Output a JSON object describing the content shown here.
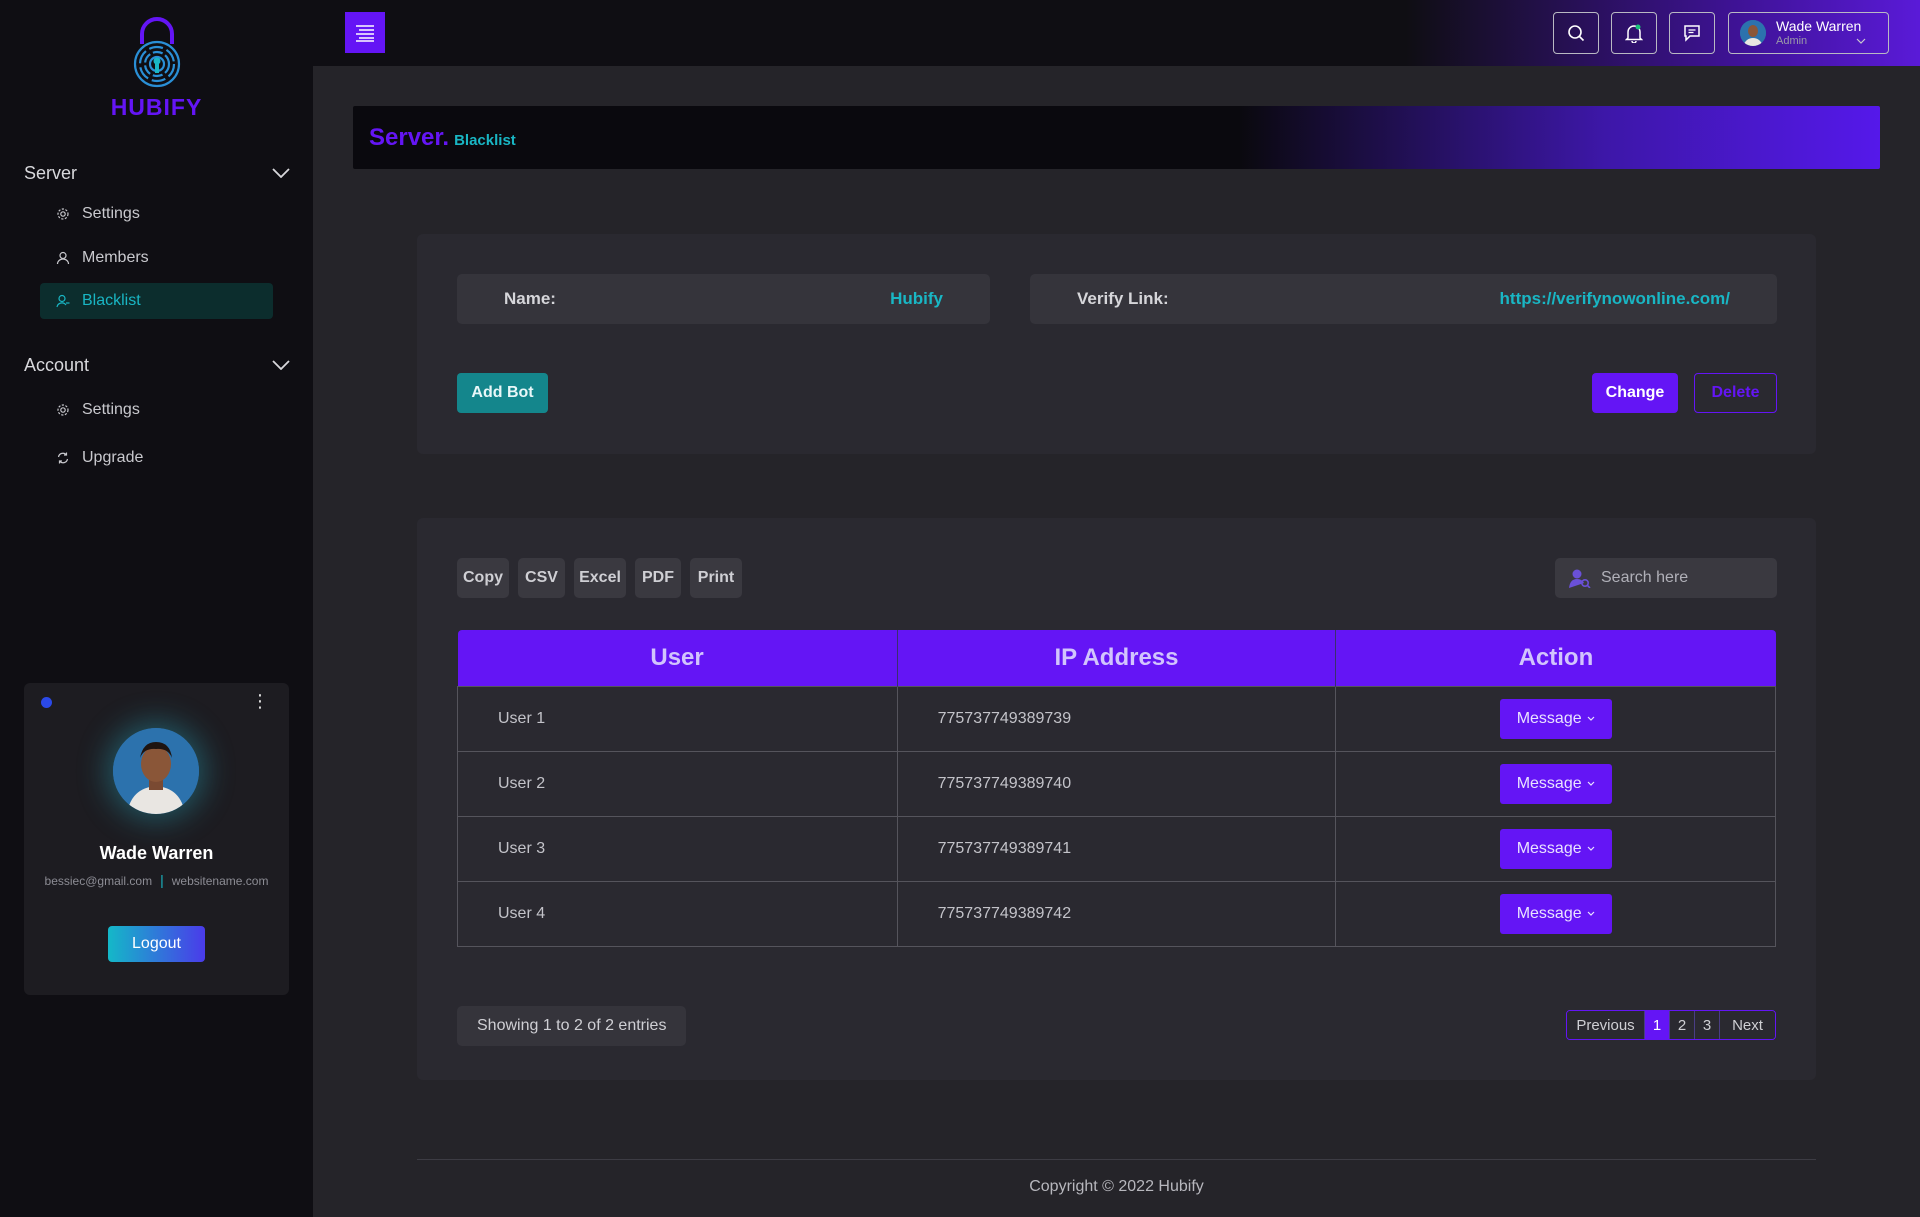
{
  "brand": {
    "name": "HUBIFY"
  },
  "sidebar": {
    "sections": [
      {
        "title": "Server",
        "items": [
          {
            "label": "Settings",
            "icon": "gear-icon"
          },
          {
            "label": "Members",
            "icon": "user-icon"
          },
          {
            "label": "Blacklist",
            "icon": "user-block-icon",
            "active": true
          }
        ]
      },
      {
        "title": "Account",
        "items": [
          {
            "label": "Settings",
            "icon": "gear-icon"
          },
          {
            "label": "Upgrade",
            "icon": "refresh-icon"
          }
        ]
      }
    ],
    "profile": {
      "name": "Wade Warren",
      "email": "bessiec@gmail.com",
      "website": "websitename.com",
      "logout_label": "Logout",
      "status_color": "#2b49e8"
    }
  },
  "topbar": {
    "user": {
      "name": "Wade Warren",
      "role": "Admin"
    }
  },
  "page_header": {
    "title": "Server.",
    "subtitle": "Blacklist"
  },
  "server_info": {
    "name_label": "Name:",
    "name_value": "Hubify",
    "verify_label": "Verify Link:",
    "verify_value": "https://verifynowonline.com/",
    "add_bot_label": "Add Bot",
    "change_label": "Change",
    "delete_label": "Delete"
  },
  "table": {
    "export_buttons": [
      "Copy",
      "CSV",
      "Excel",
      "PDF",
      "Print"
    ],
    "search_placeholder": "Search here",
    "columns": [
      "User",
      "IP Address",
      "Action"
    ],
    "rows": [
      {
        "user": "User 1",
        "ip": "775737749389739",
        "action": "Message"
      },
      {
        "user": "User 2",
        "ip": "775737749389740",
        "action": "Message"
      },
      {
        "user": "User 3",
        "ip": "775737749389741",
        "action": "Message"
      },
      {
        "user": "User 4",
        "ip": "775737749389742",
        "action": "Message"
      }
    ],
    "showing_text": "Showing 1 to 2 of 2 entries",
    "pagination": {
      "previous": "Previous",
      "pages": [
        "1",
        "2",
        "3"
      ],
      "current": "1",
      "next": "Next"
    }
  },
  "footer": {
    "text": "Copyright © 2022 Hubify"
  },
  "colors": {
    "accent": "#6415f5",
    "teal": "#19b6c4",
    "sidebar_bg": "#0f0e13",
    "content_bg": "#252429"
  }
}
